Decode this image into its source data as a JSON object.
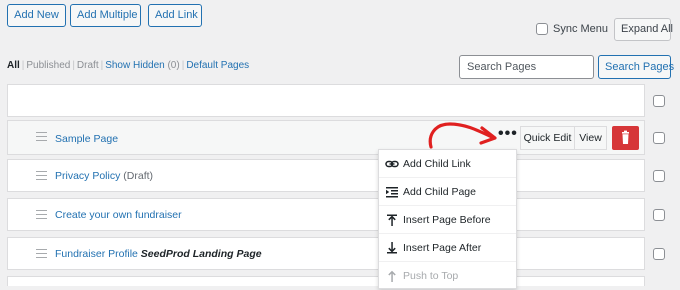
{
  "toolbar": {
    "add_new": "Add New",
    "add_multiple": "Add Multiple",
    "add_link": "Add Link",
    "sync_menu": "Sync Menu",
    "expand_all": "Expand All"
  },
  "filters": {
    "all": "All",
    "published": "Published",
    "draft": "Draft",
    "show_hidden": "Show Hidden",
    "hidden_count": "(0)",
    "default_pages": "Default Pages"
  },
  "search": {
    "placeholder": "Search Pages",
    "button": "Search Pages"
  },
  "row_actions": {
    "quick_edit": "Quick Edit",
    "view": "View"
  },
  "pages": [
    {
      "title": "Sample Page",
      "state": "",
      "tag": ""
    },
    {
      "title": "Privacy Policy",
      "state": "(Draft)",
      "tag": ""
    },
    {
      "title": "Create your own fundraiser",
      "state": "",
      "tag": ""
    },
    {
      "title": "Fundraiser Profile",
      "state": "",
      "tag": "SeedProd Landing Page"
    }
  ],
  "dropdown": [
    {
      "label": "Add Child Link",
      "icon": "link-icon"
    },
    {
      "label": "Add Child Page",
      "icon": "indent-icon"
    },
    {
      "label": "Insert Page Before",
      "icon": "insert-before-icon"
    },
    {
      "label": "Insert Page After",
      "icon": "insert-after-icon"
    },
    {
      "label": "Push to Top",
      "icon": "push-top-icon"
    }
  ],
  "colors": {
    "accent": "#2271b1",
    "delete": "#d63638",
    "annotation_arrow": "#e02020"
  }
}
